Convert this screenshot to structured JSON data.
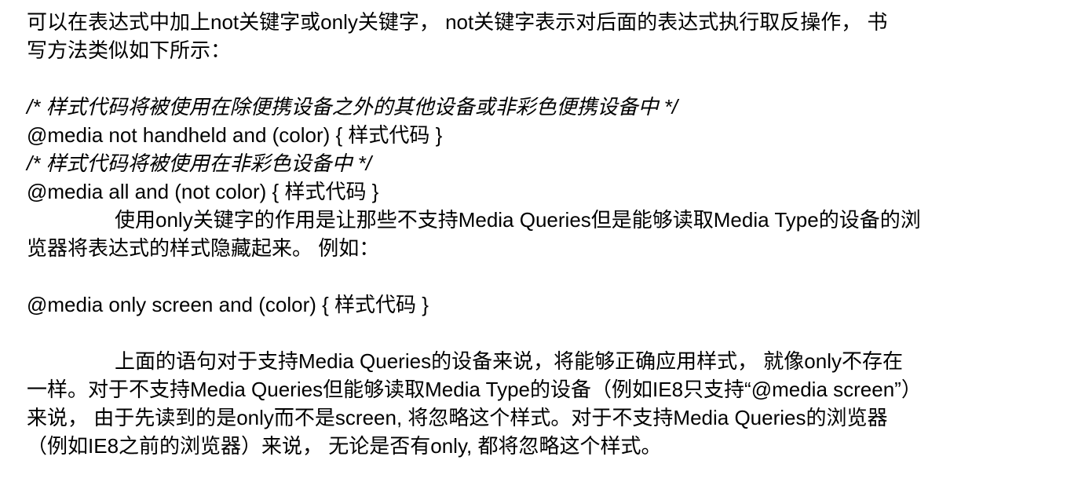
{
  "document": {
    "lines": [
      " 可以在表达式中加上not关键字或only关键字， not关键字表示对后面的表达式执行取反操作， 书",
      "写方法类似如下所示：",
      "/* 样式代码将被使用在除便携设备之外的其他设备或非彩色便携设备中 */",
      "@media not handheld and (color) { 样式代码 }",
      "/* 样式代码将被使用在非彩色设备中 */",
      "@media all and (not color) { 样式代码 }",
      "使用only关键字的作用是让那些不支持Media Queries但是能够读取Media Type的设备的浏",
      "览器将表达式的样式隐藏起来。 例如：",
      "@media only screen and (color) { 样式代码 }",
      "上面的语句对于支持Media Queries的设备来说，将能够正确应用样式， 就像only不存在",
      "一样。对于不支持Media Queries但能够读取Media Type的设备（例如IE8只支持“@media screen”）",
      "来说， 由于先读到的是only而不是screen, 将忽略这个样式。对于不支持Media Queries的浏览器",
      "（例如IE8之前的浏览器）来说， 无论是否有only, 都将忽略这个样式。"
    ]
  }
}
